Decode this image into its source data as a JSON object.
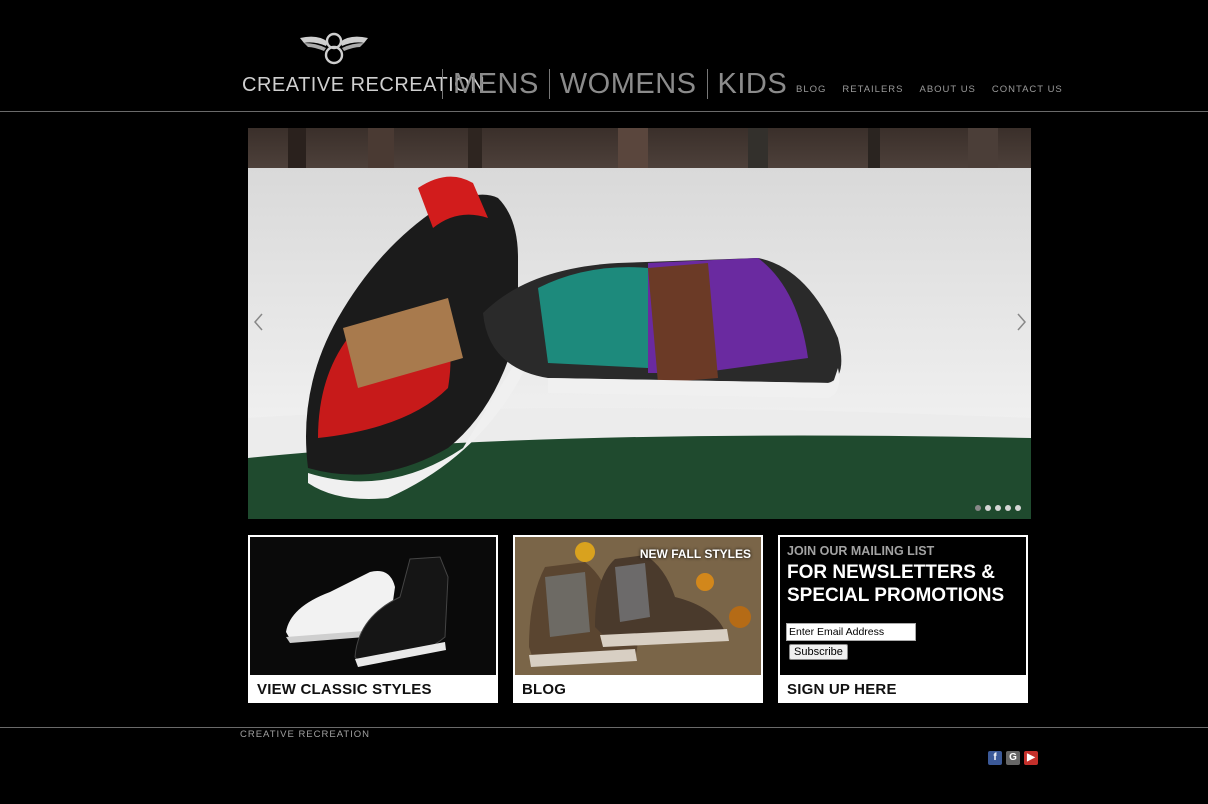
{
  "header": {
    "brand": "CREATIVE RECREATION",
    "main_nav": [
      "MENS",
      "WOMENS",
      "KIDS"
    ],
    "secondary_nav": [
      "BLOG",
      "RETAILERS",
      "ABOUT US",
      "CONTACT US"
    ]
  },
  "hero": {
    "slide_count": 5,
    "active_slide": 0
  },
  "promos": {
    "classic": {
      "caption": "VIEW CLASSIC STYLES"
    },
    "blog": {
      "caption": "BLOG",
      "tag": "NEW FALL STYLES"
    },
    "signup": {
      "kicker": "JOIN OUR MAILING LIST",
      "headline1": "FOR NEWSLETTERS &",
      "headline2": "SPECIAL PROMOTIONS",
      "email_value": "Enter Email Address",
      "button_label": "Subscribe",
      "caption": "SIGN UP HERE"
    }
  },
  "footer": {
    "brand": "CREATIVE RECREATION",
    "social": [
      "facebook-icon",
      "google-icon",
      "youtube-icon"
    ]
  },
  "colors": {
    "background": "#000000",
    "nav_text": "#8b8b8b",
    "facebook": "#3b5998",
    "google": "#666666",
    "youtube": "#c4302b"
  }
}
